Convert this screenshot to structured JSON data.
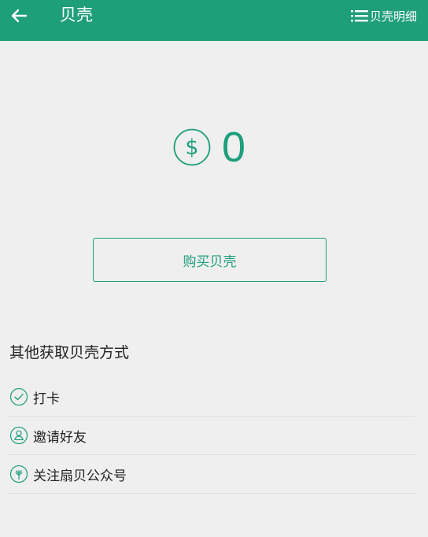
{
  "header": {
    "title": "贝壳",
    "detail_label": "贝壳明细"
  },
  "balance": {
    "amount": "0"
  },
  "buy_label": "购买贝壳",
  "other": {
    "title": "其他获取贝壳方式",
    "items": [
      {
        "label": "打卡",
        "icon": "check-circle-icon"
      },
      {
        "label": "邀请好友",
        "icon": "invite-user-icon"
      },
      {
        "label": "关注扇贝公众号",
        "icon": "wheat-icon"
      }
    ]
  },
  "colors": {
    "brand": "#1f9e7c",
    "background": "#efefef"
  }
}
